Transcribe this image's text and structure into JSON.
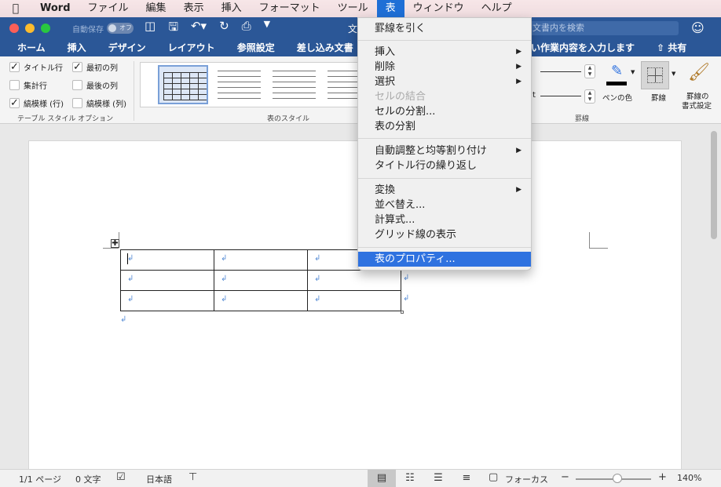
{
  "menubar": {
    "app": "Word",
    "items": [
      "ファイル",
      "編集",
      "表示",
      "挿入",
      "フォーマット",
      "ツール",
      "表",
      "ウィンドウ",
      "ヘルプ"
    ],
    "active": "表"
  },
  "titlebar": {
    "autosave_label": "自動保存",
    "autosave_state": "オフ",
    "doc_title": "文",
    "search_placeholder": "文書内を検索"
  },
  "ribbon_tabs": {
    "items": [
      "ホーム",
      "挿入",
      "デザイン",
      "レイアウト",
      "参照設定",
      "差し込み文書"
    ],
    "tell_me": "い作業内容を入力します",
    "share": "共有"
  },
  "ribbon": {
    "style_options": {
      "header_row": {
        "label": "タイトル行",
        "checked": true
      },
      "first_column": {
        "label": "最初の列",
        "checked": true
      },
      "total_row": {
        "label": "集計行",
        "checked": false
      },
      "last_column": {
        "label": "最後の列",
        "checked": false
      },
      "banded_rows": {
        "label": "縞模様 (行)",
        "checked": true
      },
      "banded_columns": {
        "label": "縞模様 (列)",
        "checked": false
      },
      "group_label": "テーブル スタイル オプション"
    },
    "table_styles_label": "表のスタイル",
    "borders": {
      "line_weight_label": "t",
      "pen_color_label": "ペンの色",
      "borders_label": "罫線",
      "border_painter_label_1": "罫線の",
      "border_painter_label_2": "書式設定",
      "group_label": "罫線"
    }
  },
  "table_menu": {
    "items": [
      {
        "label": "罫線を引く",
        "submenu": false,
        "enabled": true
      },
      {
        "label": "挿入",
        "submenu": true,
        "enabled": true
      },
      {
        "label": "削除",
        "submenu": true,
        "enabled": true
      },
      {
        "label": "選択",
        "submenu": true,
        "enabled": true
      },
      {
        "label": "セルの結合",
        "submenu": false,
        "enabled": false
      },
      {
        "label": "セルの分割...",
        "submenu": false,
        "enabled": true
      },
      {
        "label": "表の分割",
        "submenu": false,
        "enabled": true
      },
      {
        "label": "自動調整と均等割り付け",
        "submenu": true,
        "enabled": true
      },
      {
        "label": "タイトル行の繰り返し",
        "submenu": false,
        "enabled": true
      },
      {
        "label": "変換",
        "submenu": true,
        "enabled": true
      },
      {
        "label": "並べ替え...",
        "submenu": false,
        "enabled": true
      },
      {
        "label": "計算式...",
        "submenu": false,
        "enabled": true
      },
      {
        "label": "グリッド線の表示",
        "submenu": false,
        "enabled": true
      },
      {
        "label": "表のプロパティ...",
        "submenu": false,
        "enabled": true,
        "highlighted": true
      }
    ]
  },
  "document": {
    "paragraph_mark": "↲",
    "table_rows": 3,
    "table_cols": 3
  },
  "statusbar": {
    "page": "1/1 ページ",
    "words": "0 文字",
    "language": "日本語",
    "focus": "フォーカス",
    "zoom": "140%",
    "zoom_minus": "−",
    "zoom_plus": "+"
  },
  "colors": {
    "accent": "#2b5797",
    "menu_highlight": "#2f72e0",
    "paragraph_mark": "#5b8fd6"
  }
}
